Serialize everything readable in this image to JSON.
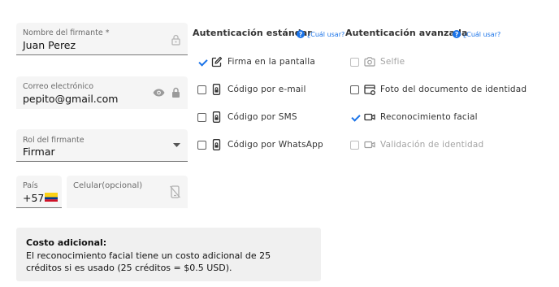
{
  "signer_form": {
    "name": {
      "label": "Nombre del firmante *",
      "value": "Juan Perez",
      "icon": "lock-icon"
    },
    "email": {
      "label": "Correo electrónico",
      "value": "pepito@gmail.com",
      "icons": [
        "eye-icon",
        "lock-icon"
      ]
    },
    "role": {
      "label": "Rol del firmante",
      "value": "Firmar",
      "icon": "caret-down-icon"
    },
    "country": {
      "label": "País",
      "value": "+57",
      "flag": "colombia-flag"
    },
    "mobile": {
      "placeholder": "Celular(opcional)",
      "icon": "phone-off-icon"
    }
  },
  "standard_auth": {
    "title": "Autenticación estándar",
    "help_label": "¿Cuál usar?",
    "options": [
      {
        "label": "Firma en la pantalla",
        "checked": true,
        "disabled": false,
        "icon": "pen-square-icon"
      },
      {
        "label": "Código por e-mail",
        "checked": false,
        "disabled": false,
        "icon": "phone-lock-icon"
      },
      {
        "label": "Código por SMS",
        "checked": false,
        "disabled": false,
        "icon": "phone-lock-icon"
      },
      {
        "label": "Código por WhatsApp",
        "checked": false,
        "disabled": false,
        "icon": "phone-lock-icon"
      }
    ]
  },
  "advanced_auth": {
    "title": "Autenticación avanzada",
    "help_label": "¿Cuál usar?",
    "options": [
      {
        "label": "Selfie",
        "checked": false,
        "disabled": true,
        "icon": "camera-icon"
      },
      {
        "label": "Foto del documento de identidad",
        "checked": false,
        "disabled": false,
        "icon": "id-card-icon"
      },
      {
        "label": "Reconocimiento facial",
        "checked": true,
        "disabled": false,
        "icon": "video-camera-icon"
      },
      {
        "label": "Validación de identidad",
        "checked": false,
        "disabled": true,
        "icon": "video-camera-icon"
      }
    ]
  },
  "notice": {
    "title": "Costo adicional:",
    "body": "El reconocimiento facial tiene un costo adicional de 25 créditos si es usado (25 créditos = $0.5 USD)."
  },
  "colors": {
    "accent": "#1a73e8",
    "field_bg": "#f5f5f5",
    "notice_bg": "#f0f0f0",
    "disabled_text": "#a3a3a3"
  }
}
